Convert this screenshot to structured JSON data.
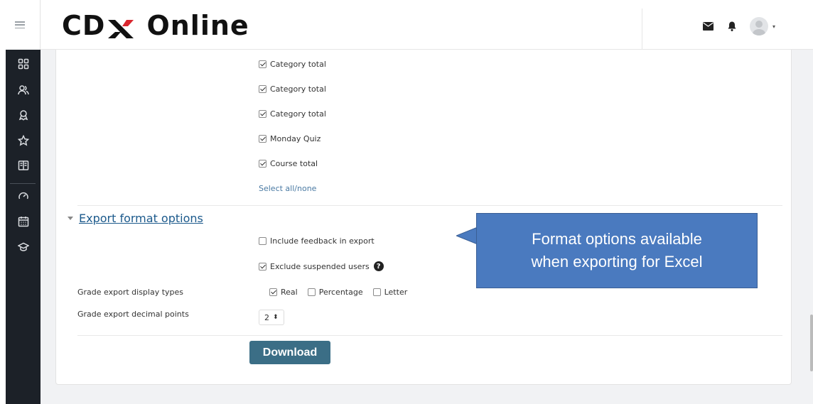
{
  "header": {
    "logo_text_left": "CD",
    "logo_text_right": "Online",
    "colors": {
      "logo_x_red": "#d9262e",
      "logo_x_black": "#111111"
    }
  },
  "nav": {
    "icons": [
      "dashboard-icon",
      "users-icon",
      "badge-icon",
      "star-icon",
      "book-icon",
      "gauge-icon",
      "calendar-icon",
      "graduation-cap-icon"
    ]
  },
  "items": [
    {
      "label": "Category total",
      "checked": true
    },
    {
      "label": "Category total",
      "checked": true
    },
    {
      "label": "Category total",
      "checked": true
    },
    {
      "label": "Monday Quiz",
      "checked": true
    },
    {
      "label": "Course total",
      "checked": true
    }
  ],
  "select_all_label": "Select all/none",
  "export_section": {
    "title": "Export format options",
    "include_feedback_label": "Include feedback in export",
    "include_feedback_checked": false,
    "exclude_suspended_label": "Exclude suspended users",
    "exclude_suspended_checked": true,
    "help_glyph": "?",
    "display_types_label": "Grade export display types",
    "display_types": [
      {
        "label": "Real",
        "checked": true
      },
      {
        "label": "Percentage",
        "checked": false
      },
      {
        "label": "Letter",
        "checked": false
      }
    ],
    "decimal_points_label": "Grade export decimal points",
    "decimal_points_value": "2",
    "decimal_points_arrow": "⬍"
  },
  "download_label": "Download",
  "callout": {
    "line1": "Format options available",
    "line2": "when exporting for Excel",
    "color": "#4a7abf"
  }
}
